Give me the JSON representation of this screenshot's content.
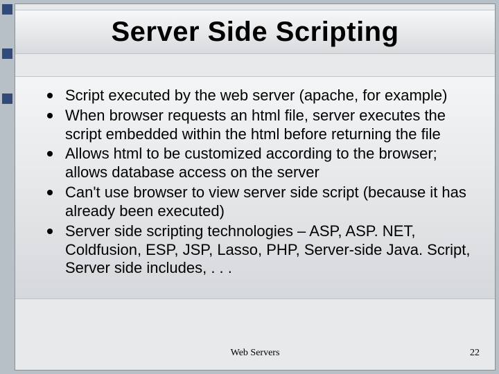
{
  "title": "Server Side Scripting",
  "bullets": [
    "Script executed by the web server (apache, for example)",
    "When browser requests an html file, server executes the script embedded within the html before returning the file",
    "Allows html to be customized according to the browser; allows database access on the server",
    "Can't use browser to view server side script (because it has already been executed)",
    "Server side scripting technologies – ASP, ASP. NET, Coldfusion, ESP, JSP, Lasso, PHP, Server-side Java. Script, Server side includes, . . ."
  ],
  "footer": {
    "center": "Web Servers",
    "page": "22"
  }
}
